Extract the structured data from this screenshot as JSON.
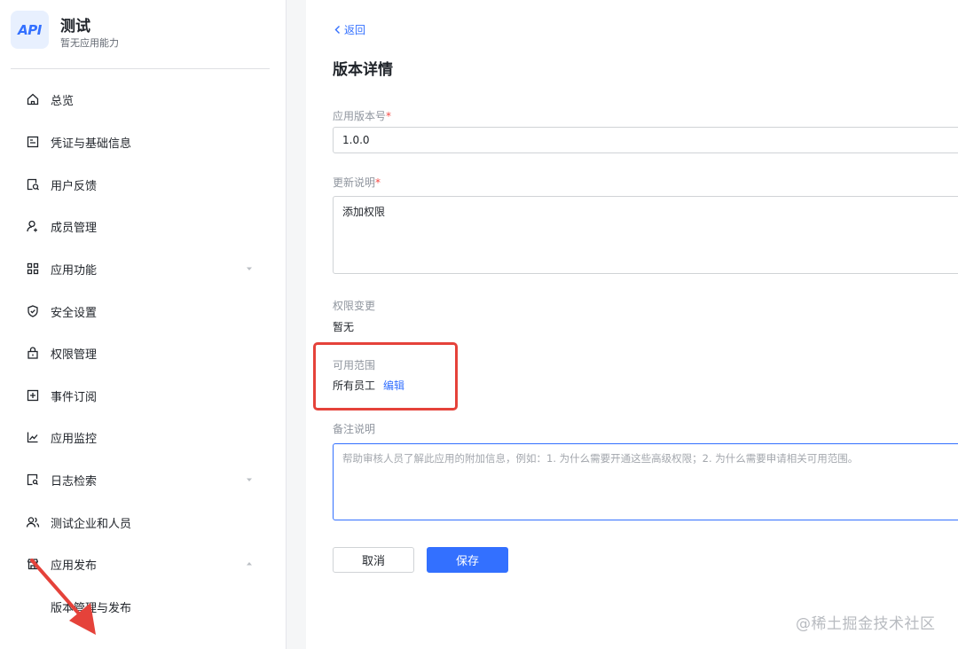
{
  "app": {
    "logo_text": "API",
    "name": "测试",
    "subtitle": "暂无应用能力"
  },
  "sidebar": {
    "items": [
      {
        "label": "总览",
        "icon": "home-icon"
      },
      {
        "label": "凭证与基础信息",
        "icon": "credential-icon"
      },
      {
        "label": "用户反馈",
        "icon": "feedback-icon"
      },
      {
        "label": "成员管理",
        "icon": "member-icon"
      },
      {
        "label": "应用功能",
        "icon": "grid-icon",
        "caret": "down"
      },
      {
        "label": "安全设置",
        "icon": "shield-icon"
      },
      {
        "label": "权限管理",
        "icon": "lock-icon"
      },
      {
        "label": "事件订阅",
        "icon": "plus-square-icon"
      },
      {
        "label": "应用监控",
        "icon": "chart-icon"
      },
      {
        "label": "日志检索",
        "icon": "log-search-icon",
        "caret": "down"
      },
      {
        "label": "测试企业和人员",
        "icon": "users-icon"
      },
      {
        "label": "应用发布",
        "icon": "store-icon",
        "caret": "up"
      }
    ],
    "sub_items": [
      {
        "label": "版本管理与发布"
      }
    ]
  },
  "main": {
    "back_label": "返回",
    "title": "版本详情",
    "version": {
      "label": "应用版本号",
      "required_mark": "*",
      "value": "1.0.0"
    },
    "update_notes": {
      "label": "更新说明",
      "required_mark": "*",
      "value": "添加权限"
    },
    "permission_change": {
      "label": "权限变更",
      "value": "暂无"
    },
    "scope": {
      "label": "可用范围",
      "value": "所有员工",
      "edit_label": "编辑"
    },
    "remarks": {
      "label": "备注说明",
      "placeholder": "帮助审核人员了解此应用的附加信息，例如：1. 为什么需要开通这些高级权限；2. 为什么需要申请相关可用范围。"
    },
    "cancel_label": "取消",
    "save_label": "保存"
  },
  "watermark": "@稀土掘金技术社区",
  "colors": {
    "accent": "#3370ff",
    "annotation": "#e5423a"
  }
}
